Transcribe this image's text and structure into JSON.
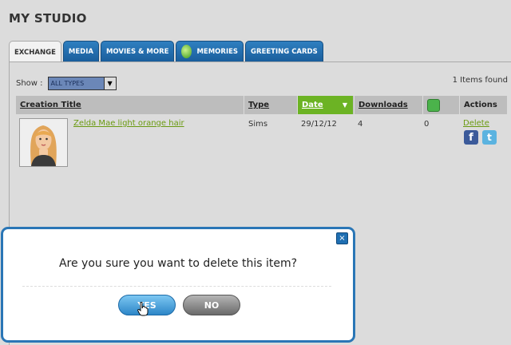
{
  "page": {
    "title": "MY STUDIO"
  },
  "tabs": [
    {
      "label": "EXCHANGE",
      "active": true
    },
    {
      "label": "MEDIA"
    },
    {
      "label": "MOVIES & MORE"
    },
    {
      "label": "MEMORIES",
      "icon": "sims-plumbob-icon"
    },
    {
      "label": "GREETING CARDS"
    }
  ],
  "filter": {
    "label": "Show :",
    "value": "ALL TYPES"
  },
  "results": {
    "count_text": "1 Items found"
  },
  "table": {
    "columns": {
      "title": "Creation Title",
      "type": "Type",
      "date": "Date",
      "downloads": "Downloads",
      "actions": "Actions"
    },
    "rows": [
      {
        "title": "Zelda Mae light orange hair",
        "type": "Sims",
        "date": "29/12/12",
        "downloads": "4",
        "recycled": "0",
        "delete_label": "Delete"
      }
    ]
  },
  "social": {
    "facebook": "f",
    "twitter": "t"
  },
  "dialog": {
    "question": "Are you sure you want to delete this item?",
    "yes_label": "YES",
    "no_label": "NO",
    "close_glyph": "×"
  },
  "colors": {
    "accent_green": "#6cb324",
    "tab_blue": "#1a5e9c",
    "dialog_border": "#2a76b6"
  }
}
